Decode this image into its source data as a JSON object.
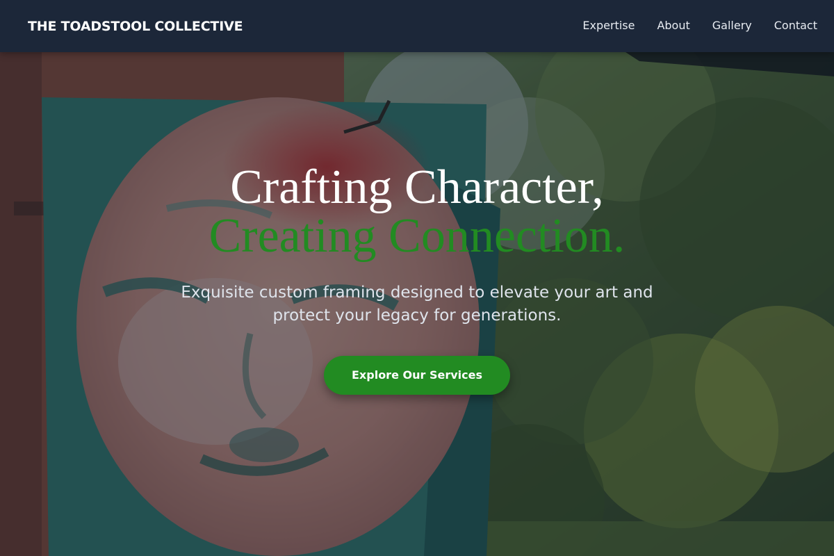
{
  "header": {
    "brand": "THE TOADSTOOL COLLECTIVE",
    "nav": [
      {
        "label": "Expertise"
      },
      {
        "label": "About"
      },
      {
        "label": "Gallery"
      },
      {
        "label": "Contact"
      }
    ]
  },
  "hero": {
    "headline_line1": "Crafting Character,",
    "headline_line2": "Creating Connection.",
    "subtitle": "Exquisite custom framing designed to elevate your art and protect your legacy for generations.",
    "cta_label": "Explore Our Services"
  },
  "colors": {
    "nav_background": "#1c2739",
    "accent": "#228b22",
    "text_light": "#ffffff"
  }
}
